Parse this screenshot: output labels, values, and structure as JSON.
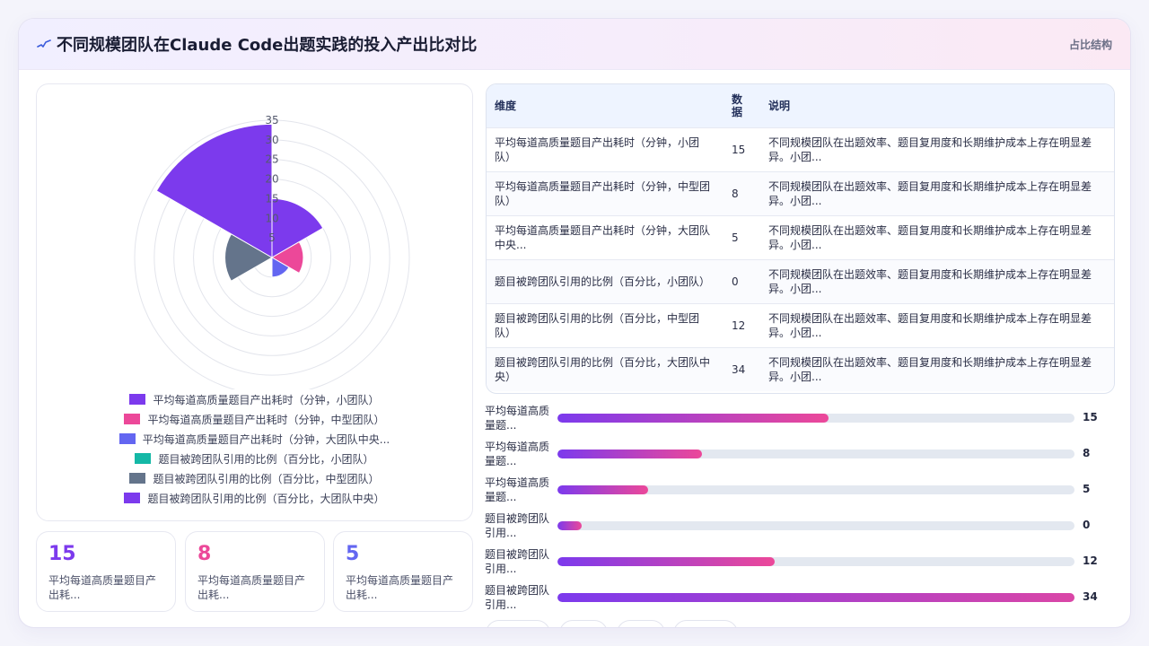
{
  "header": {
    "title": "不同规模团队在Claude Code出题实践的投入产出比对比",
    "tag": "占比结构"
  },
  "colors": {
    "series": [
      "#7c3aed",
      "#ec4899",
      "#6366f1",
      "#14b8a6",
      "#64748b",
      "#7c3aed"
    ],
    "kpi": [
      "#7c3aed",
      "#ec4899",
      "#6366f1"
    ],
    "bar_gradient": [
      "#7c3aed",
      "#ec4899"
    ]
  },
  "chart_data": {
    "type": "polar-area",
    "categories": [
      "平均每道高质量题目产出耗时（分钟，小团队）",
      "平均每道高质量题目产出耗时（分钟，中型团队）",
      "平均每道高质量题目产出耗时（分钟，大团队中央...",
      "题目被跨团队引用的比例（百分比，小团队）",
      "题目被跨团队引用的比例（百分比，中型团队）",
      "题目被跨团队引用的比例（百分比，大团队中央）"
    ],
    "values": [
      15,
      8,
      5,
      0,
      12,
      34
    ],
    "r_ticks": [
      "5",
      "10",
      "15",
      "20",
      "25",
      "30",
      "35"
    ],
    "rlim": [
      0,
      35
    ],
    "legend_position": "bottom",
    "grid": true
  },
  "table": {
    "headers": [
      "维度",
      "数据",
      "说明"
    ],
    "rows": [
      [
        "平均每道高质量题目产出耗时（分钟，小团队）",
        "15",
        "不同规模团队在出题效率、题目复用度和长期维护成本上存在明显差异。小团..."
      ],
      [
        "平均每道高质量题目产出耗时（分钟，中型团队）",
        "8",
        "不同规模团队在出题效率、题目复用度和长期维护成本上存在明显差异。小团..."
      ],
      [
        "平均每道高质量题目产出耗时（分钟，大团队中央...",
        "5",
        "不同规模团队在出题效率、题目复用度和长期维护成本上存在明显差异。小团..."
      ],
      [
        "题目被跨团队引用的比例（百分比，小团队）",
        "0",
        "不同规模团队在出题效率、题目复用度和长期维护成本上存在明显差异。小团..."
      ],
      [
        "题目被跨团队引用的比例（百分比，中型团队）",
        "12",
        "不同规模团队在出题效率、题目复用度和长期维护成本上存在明显差异。小团..."
      ],
      [
        "题目被跨团队引用的比例（百分比，大团队中央）",
        "34",
        "不同规模团队在出题效率、题目复用度和长期维护成本上存在明显差异。小团..."
      ]
    ]
  },
  "kpis": [
    {
      "value": "15",
      "label": "平均每道高质量题目产出耗..."
    },
    {
      "value": "8",
      "label": "平均每道高质量题目产出耗..."
    },
    {
      "value": "5",
      "label": "平均每道高质量题目产出耗..."
    }
  ],
  "bars": {
    "max": 34,
    "items": [
      {
        "label": "平均每道高质量题...",
        "value": 15
      },
      {
        "label": "平均每道高质量题...",
        "value": 8
      },
      {
        "label": "平均每道高质量题...",
        "value": 5
      },
      {
        "label": "题目被跨团队引用...",
        "value": 0
      },
      {
        "label": "题目被跨团队引用...",
        "value": 12
      },
      {
        "label": "题目被跨团队引用...",
        "value": 34
      }
    ]
  }
}
